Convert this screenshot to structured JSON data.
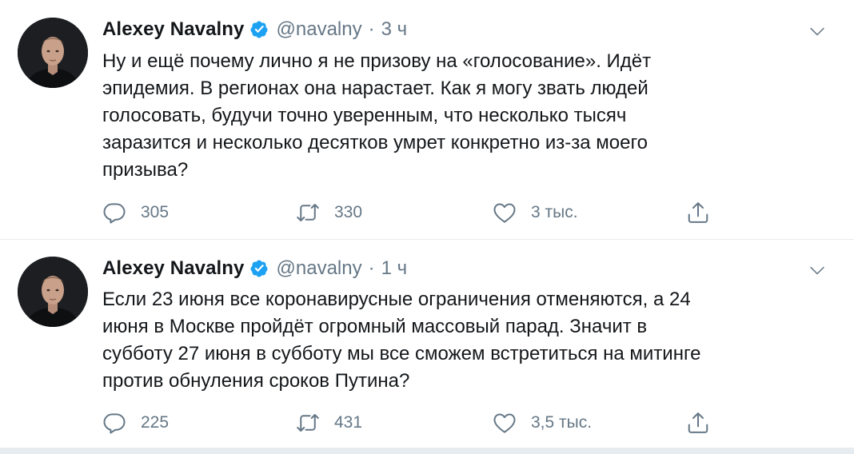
{
  "tweets": [
    {
      "author": {
        "name": "Alexey Navalny",
        "handle": "@navalny",
        "verified": true
      },
      "time": "3 ч",
      "separator": "·",
      "text_lines": [
        "Ну и ещё почему лично я не призову на «голосование». Идёт",
        "эпидемия. В регионах она нарастает. Как я могу звать людей",
        "голосовать, будучи точно уверенным, что несколько тысяч",
        "заразится и несколько десятков умрет конкретно из-за моего",
        "призыва?"
      ],
      "stats": {
        "replies": "305",
        "retweets": "330",
        "likes": "3 тыс."
      }
    },
    {
      "author": {
        "name": "Alexey Navalny",
        "handle": "@navalny",
        "verified": true
      },
      "time": "1 ч",
      "separator": "·",
      "text_lines": [
        "Если 23 июня все коронавирусные ограничения отменяются, а 24",
        "июня в Москве пройдёт огромный массовый парад. Значит в",
        "субботу 27 июня в субботу мы все сможем встретиться на митинге",
        "против обнуления сроков Путина?"
      ],
      "stats": {
        "replies": "225",
        "retweets": "431",
        "likes": "3,5 тыс."
      }
    }
  ],
  "colors": {
    "text": "#14171a",
    "secondary": "#657786",
    "verified": "#1da1f2",
    "divider": "#e6ecf0"
  },
  "icons": {
    "reply": "speech-bubble-outline",
    "retweet": "two-arrows-loop",
    "like": "heart-outline",
    "share": "upload-arrow",
    "menu": "chevron-down",
    "verified": "check-badge"
  }
}
